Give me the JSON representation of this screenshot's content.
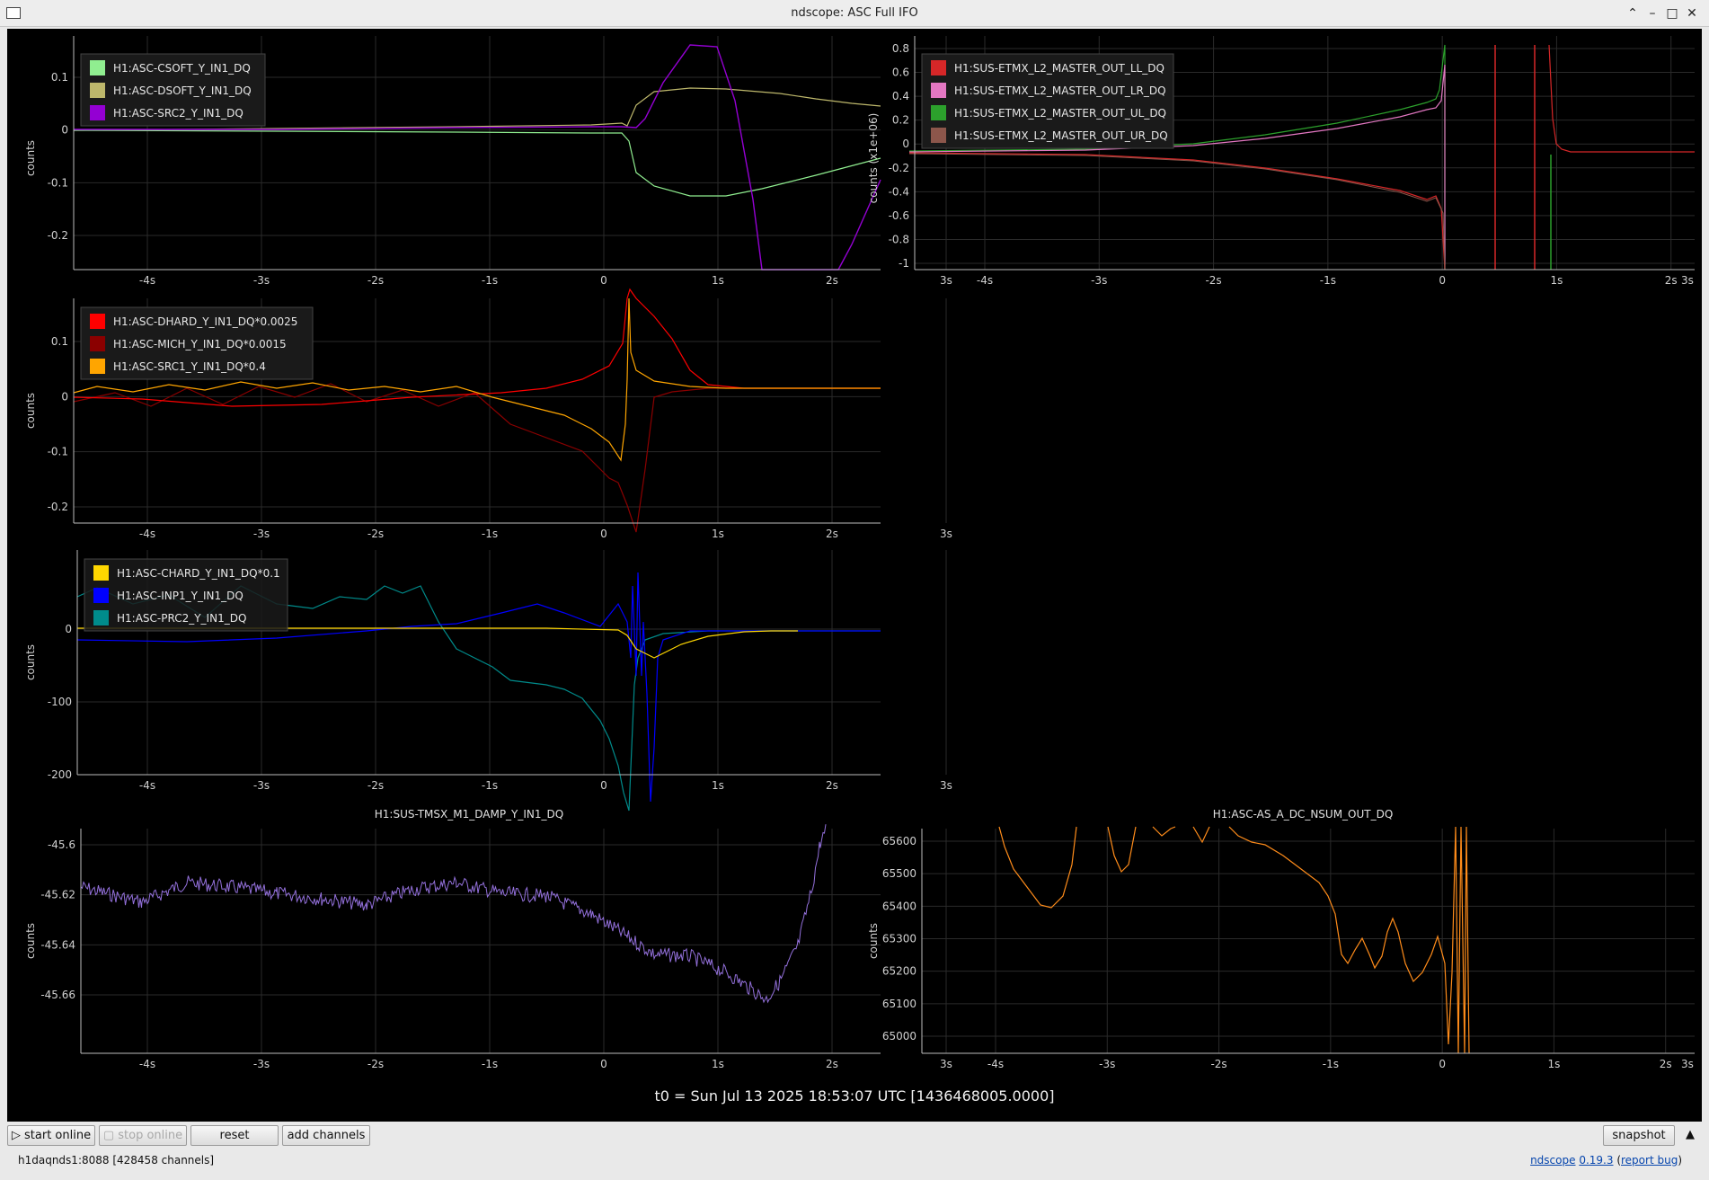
{
  "window": {
    "title": "ndscope: ASC Full IFO",
    "buttons": [
      "⌃",
      "–",
      "□",
      "✕"
    ]
  },
  "time_axis": {
    "ticks": [
      "-4s",
      "-3s",
      "-2s",
      "-1s",
      "0",
      "1s",
      "2s",
      "3s"
    ],
    "t0_label": "t0 = Sun Jul 13 2025 18:53:07 UTC [1436468005.0000]"
  },
  "plots": {
    "p1": {
      "ylabel": "counts",
      "yticks": [
        "0.1",
        "0",
        "-0.1",
        "-0.2"
      ],
      "legend": [
        {
          "label": "H1:ASC-CSOFT_Y_IN1_DQ",
          "color": "#90ee90"
        },
        {
          "label": "H1:ASC-DSOFT_Y_IN1_DQ",
          "color": "#bdb76b"
        },
        {
          "label": "H1:ASC-SRC2_Y_IN1_DQ",
          "color": "#9400d3"
        }
      ]
    },
    "p2": {
      "ylabel": "counts (x1e+06)",
      "yticks": [
        "0.8",
        "0.6",
        "0.4",
        "0.2",
        "0",
        "-0.2",
        "-0.4",
        "-0.6",
        "-0.8",
        "-1"
      ],
      "legend": [
        {
          "label": "H1:SUS-ETMX_L2_MASTER_OUT_LL_DQ",
          "color": "#d62728"
        },
        {
          "label": "H1:SUS-ETMX_L2_MASTER_OUT_LR_DQ",
          "color": "#e377c2"
        },
        {
          "label": "H1:SUS-ETMX_L2_MASTER_OUT_UL_DQ",
          "color": "#2ca02c"
        },
        {
          "label": "H1:SUS-ETMX_L2_MASTER_OUT_UR_DQ",
          "color": "#8c564b"
        }
      ]
    },
    "p3": {
      "ylabel": "counts",
      "yticks": [
        "0.1",
        "0",
        "-0.1",
        "-0.2"
      ],
      "legend": [
        {
          "label": "H1:ASC-DHARD_Y_IN1_DQ*0.0025",
          "color": "#ff0000"
        },
        {
          "label": "H1:ASC-MICH_Y_IN1_DQ*0.0015",
          "color": "#8b0000"
        },
        {
          "label": "H1:ASC-SRC1_Y_IN1_DQ*0.4",
          "color": "#ffa500"
        }
      ]
    },
    "p4": {
      "ylabel": "counts",
      "yticks": [
        "0",
        "-100",
        "-200"
      ],
      "legend": [
        {
          "label": "H1:ASC-CHARD_Y_IN1_DQ*0.1",
          "color": "#ffd700"
        },
        {
          "label": "H1:ASC-INP1_Y_IN1_DQ",
          "color": "#0000ff"
        },
        {
          "label": "H1:ASC-PRC2_Y_IN1_DQ",
          "color": "#008b8b"
        }
      ]
    },
    "p5": {
      "title": "H1:SUS-TMSX_M1_DAMP_Y_IN1_DQ",
      "ylabel": "counts",
      "yticks": [
        "-45.6",
        "-45.62",
        "-45.64",
        "-45.66"
      ],
      "color": "#9370db"
    },
    "p6": {
      "title": "H1:ASC-AS_A_DC_NSUM_OUT_DQ",
      "ylabel": "counts",
      "yticks": [
        "65600",
        "65500",
        "65400",
        "65300",
        "65200",
        "65100",
        "65000"
      ],
      "color": "#ff8c1a"
    }
  },
  "controls": {
    "start_online": "▷ start online",
    "stop_online": "▢ stop online",
    "reset": "reset",
    "add_channels": "add channels",
    "snapshot": "snapshot",
    "expand": "▲"
  },
  "status": {
    "server": "h1daqnds1:8088  [428458 channels]",
    "app_name": "ndscope",
    "version": "0.19.3",
    "report_bug": "report bug"
  }
}
